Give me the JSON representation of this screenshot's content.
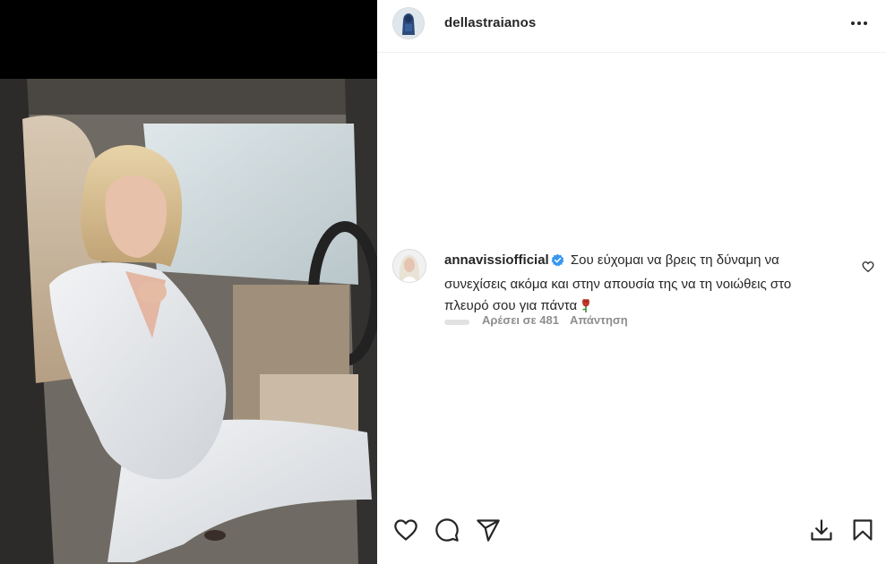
{
  "post": {
    "author": "dellastraianos",
    "more_icon": "more-horizontal-icon"
  },
  "comment": {
    "user": "annavissiofficial",
    "verified": true,
    "text": "Σου εύχομαι να βρεις τη δύναμη να συνεχίσεις ακόμα και στην απουσία της να τη νοιώθεις στο πλευρό σου για πάντα",
    "emoji": "rose",
    "likes_label": "Αρέσει σε 481",
    "reply_label": "Απάντηση"
  },
  "actions": {
    "like_icon": "heart-icon",
    "comment_icon": "comment-icon",
    "share_icon": "send-icon",
    "download_icon": "download-icon",
    "save_icon": "bookmark-icon"
  },
  "colors": {
    "verified": "#3897f0",
    "text": "#262626",
    "muted": "#8e8e8e",
    "rose": "#c0392b"
  }
}
